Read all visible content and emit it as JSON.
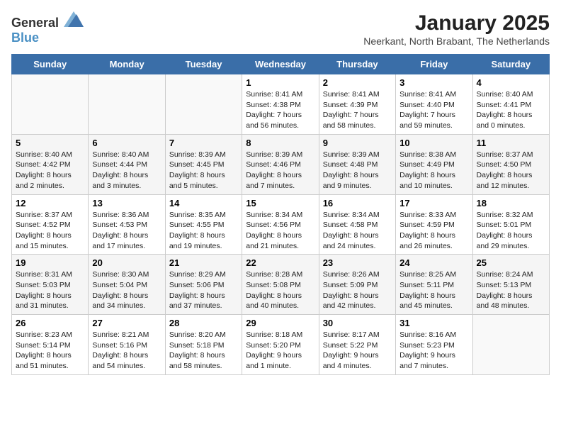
{
  "logo": {
    "text_general": "General",
    "text_blue": "Blue"
  },
  "title": "January 2025",
  "subtitle": "Neerkant, North Brabant, The Netherlands",
  "header_days": [
    "Sunday",
    "Monday",
    "Tuesday",
    "Wednesday",
    "Thursday",
    "Friday",
    "Saturday"
  ],
  "weeks": [
    [
      {
        "day": "",
        "info": ""
      },
      {
        "day": "",
        "info": ""
      },
      {
        "day": "",
        "info": ""
      },
      {
        "day": "1",
        "info": "Sunrise: 8:41 AM\nSunset: 4:38 PM\nDaylight: 7 hours\nand 56 minutes."
      },
      {
        "day": "2",
        "info": "Sunrise: 8:41 AM\nSunset: 4:39 PM\nDaylight: 7 hours\nand 58 minutes."
      },
      {
        "day": "3",
        "info": "Sunrise: 8:41 AM\nSunset: 4:40 PM\nDaylight: 7 hours\nand 59 minutes."
      },
      {
        "day": "4",
        "info": "Sunrise: 8:40 AM\nSunset: 4:41 PM\nDaylight: 8 hours\nand 0 minutes."
      }
    ],
    [
      {
        "day": "5",
        "info": "Sunrise: 8:40 AM\nSunset: 4:42 PM\nDaylight: 8 hours\nand 2 minutes."
      },
      {
        "day": "6",
        "info": "Sunrise: 8:40 AM\nSunset: 4:44 PM\nDaylight: 8 hours\nand 3 minutes."
      },
      {
        "day": "7",
        "info": "Sunrise: 8:39 AM\nSunset: 4:45 PM\nDaylight: 8 hours\nand 5 minutes."
      },
      {
        "day": "8",
        "info": "Sunrise: 8:39 AM\nSunset: 4:46 PM\nDaylight: 8 hours\nand 7 minutes."
      },
      {
        "day": "9",
        "info": "Sunrise: 8:39 AM\nSunset: 4:48 PM\nDaylight: 8 hours\nand 9 minutes."
      },
      {
        "day": "10",
        "info": "Sunrise: 8:38 AM\nSunset: 4:49 PM\nDaylight: 8 hours\nand 10 minutes."
      },
      {
        "day": "11",
        "info": "Sunrise: 8:37 AM\nSunset: 4:50 PM\nDaylight: 8 hours\nand 12 minutes."
      }
    ],
    [
      {
        "day": "12",
        "info": "Sunrise: 8:37 AM\nSunset: 4:52 PM\nDaylight: 8 hours\nand 15 minutes."
      },
      {
        "day": "13",
        "info": "Sunrise: 8:36 AM\nSunset: 4:53 PM\nDaylight: 8 hours\nand 17 minutes."
      },
      {
        "day": "14",
        "info": "Sunrise: 8:35 AM\nSunset: 4:55 PM\nDaylight: 8 hours\nand 19 minutes."
      },
      {
        "day": "15",
        "info": "Sunrise: 8:34 AM\nSunset: 4:56 PM\nDaylight: 8 hours\nand 21 minutes."
      },
      {
        "day": "16",
        "info": "Sunrise: 8:34 AM\nSunset: 4:58 PM\nDaylight: 8 hours\nand 24 minutes."
      },
      {
        "day": "17",
        "info": "Sunrise: 8:33 AM\nSunset: 4:59 PM\nDaylight: 8 hours\nand 26 minutes."
      },
      {
        "day": "18",
        "info": "Sunrise: 8:32 AM\nSunset: 5:01 PM\nDaylight: 8 hours\nand 29 minutes."
      }
    ],
    [
      {
        "day": "19",
        "info": "Sunrise: 8:31 AM\nSunset: 5:03 PM\nDaylight: 8 hours\nand 31 minutes."
      },
      {
        "day": "20",
        "info": "Sunrise: 8:30 AM\nSunset: 5:04 PM\nDaylight: 8 hours\nand 34 minutes."
      },
      {
        "day": "21",
        "info": "Sunrise: 8:29 AM\nSunset: 5:06 PM\nDaylight: 8 hours\nand 37 minutes."
      },
      {
        "day": "22",
        "info": "Sunrise: 8:28 AM\nSunset: 5:08 PM\nDaylight: 8 hours\nand 40 minutes."
      },
      {
        "day": "23",
        "info": "Sunrise: 8:26 AM\nSunset: 5:09 PM\nDaylight: 8 hours\nand 42 minutes."
      },
      {
        "day": "24",
        "info": "Sunrise: 8:25 AM\nSunset: 5:11 PM\nDaylight: 8 hours\nand 45 minutes."
      },
      {
        "day": "25",
        "info": "Sunrise: 8:24 AM\nSunset: 5:13 PM\nDaylight: 8 hours\nand 48 minutes."
      }
    ],
    [
      {
        "day": "26",
        "info": "Sunrise: 8:23 AM\nSunset: 5:14 PM\nDaylight: 8 hours\nand 51 minutes."
      },
      {
        "day": "27",
        "info": "Sunrise: 8:21 AM\nSunset: 5:16 PM\nDaylight: 8 hours\nand 54 minutes."
      },
      {
        "day": "28",
        "info": "Sunrise: 8:20 AM\nSunset: 5:18 PM\nDaylight: 8 hours\nand 58 minutes."
      },
      {
        "day": "29",
        "info": "Sunrise: 8:18 AM\nSunset: 5:20 PM\nDaylight: 9 hours\nand 1 minute."
      },
      {
        "day": "30",
        "info": "Sunrise: 8:17 AM\nSunset: 5:22 PM\nDaylight: 9 hours\nand 4 minutes."
      },
      {
        "day": "31",
        "info": "Sunrise: 8:16 AM\nSunset: 5:23 PM\nDaylight: 9 hours\nand 7 minutes."
      },
      {
        "day": "",
        "info": ""
      }
    ]
  ]
}
